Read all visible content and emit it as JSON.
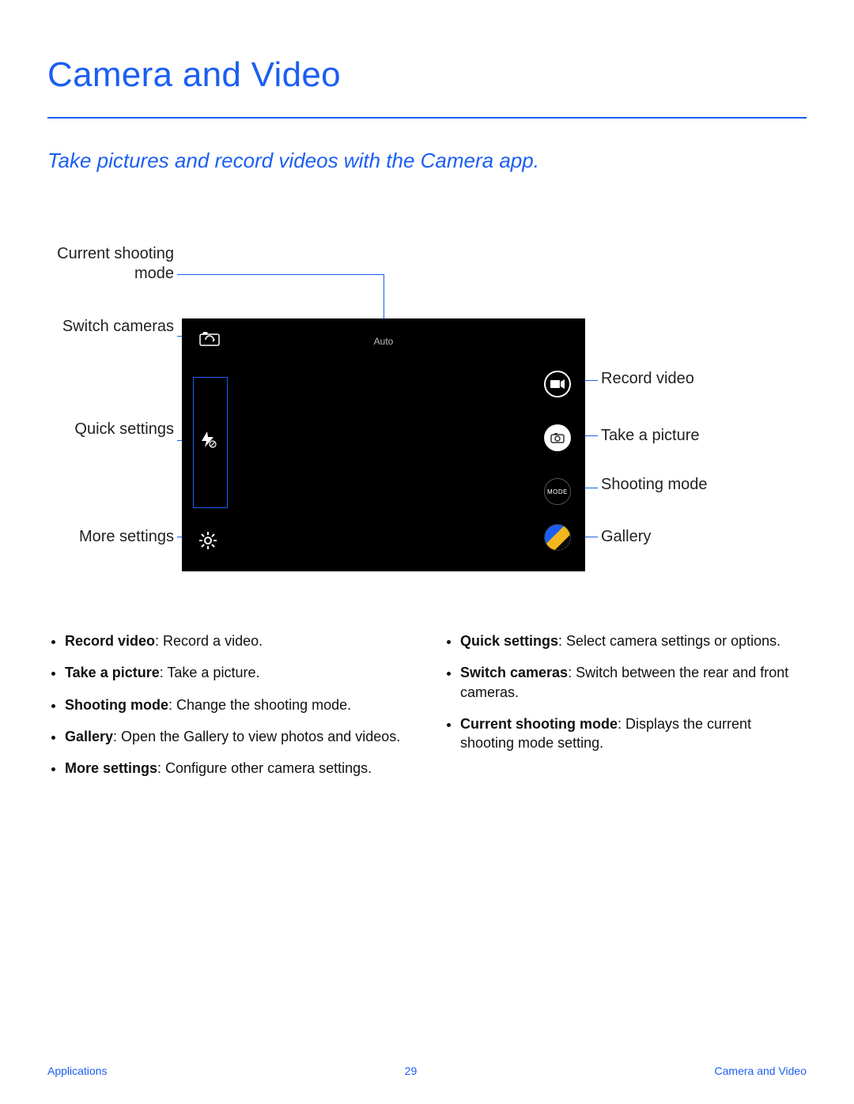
{
  "title": "Camera and Video",
  "subtitle": "Take pictures and record videos with the Camera app.",
  "diagram": {
    "mode_text": "Auto",
    "mode_btn_text": "MODE",
    "labels": {
      "current_mode": "Current shooting mode",
      "switch_cameras": "Switch cameras",
      "quick_settings": "Quick settings",
      "more_settings": "More settings",
      "record_video": "Record video",
      "take_picture": "Take a picture",
      "shooting_mode": "Shooting mode",
      "gallery": "Gallery"
    }
  },
  "bullets": {
    "left": [
      {
        "term": "Record video",
        "desc": ": Record a video."
      },
      {
        "term": "Take a picture",
        "desc": ": Take a picture."
      },
      {
        "term": "Shooting mode",
        "desc": ": Change the shooting mode."
      },
      {
        "term": "Gallery",
        "desc": ": Open the Gallery to view photos and videos."
      },
      {
        "term": "More settings",
        "desc": ": Configure other camera settings."
      }
    ],
    "right": [
      {
        "term": "Quick settings",
        "desc": ": Select camera settings or options."
      },
      {
        "term": "Switch cameras",
        "desc": ": Switch between the rear and front cameras."
      },
      {
        "term": "Current shooting mode",
        "desc": ": Displays the current shooting mode setting."
      }
    ]
  },
  "footer": {
    "left": "Applications",
    "center": "29",
    "right": "Camera and Video"
  }
}
